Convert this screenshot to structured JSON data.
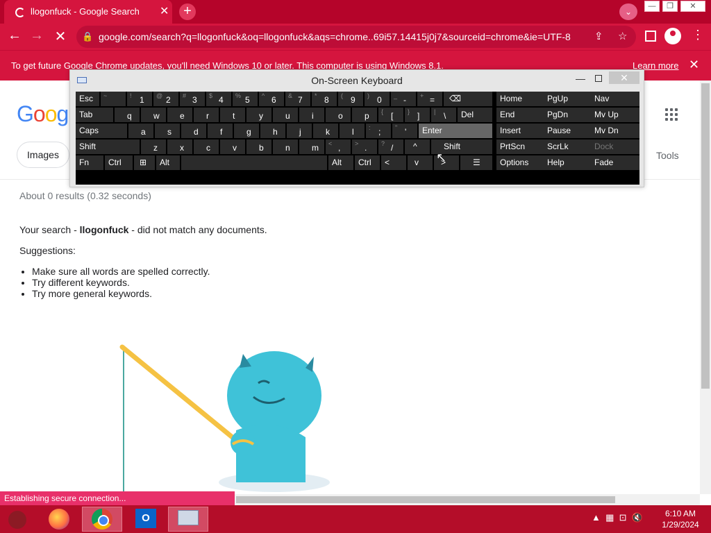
{
  "browser": {
    "tab_title": "llogonfuck - Google Search",
    "url": "google.com/search?q=llogonfuck&oq=llogonfuck&aqs=chrome..69i57.14415j0j7&sourceid=chrome&ie=UTF-8",
    "accent_color": "#d5153e"
  },
  "infobar": {
    "message": "To get future Google Chrome updates, you'll need Windows 10 or later. This computer is using Windows 8.1.",
    "link": "Learn more"
  },
  "google": {
    "logo": "Goog",
    "chip_images": "Images",
    "tools": "Tools",
    "result_stats": "About 0 results (0.32 seconds)",
    "no_match_prefix": "Your search - ",
    "query": "llogonfuck",
    "no_match_suffix": " - did not match any documents.",
    "suggestions_heading": "Suggestions:",
    "suggestions": [
      "Make sure all words are spelled correctly.",
      "Try different keywords.",
      "Try more general keywords."
    ]
  },
  "status": "Establishing secure connection...",
  "osk": {
    "title": "On-Screen Keyboard",
    "row1": [
      "Esc",
      "1",
      "2",
      "3",
      "4",
      "5",
      "6",
      "7",
      "8",
      "9",
      "0",
      "-",
      "="
    ],
    "row1_shift": [
      "~",
      "!",
      "@",
      "#",
      "$",
      "%",
      "^",
      "&",
      "*",
      "(",
      ")",
      "_",
      "+"
    ],
    "row2": [
      "Tab",
      "q",
      "w",
      "e",
      "r",
      "t",
      "y",
      "u",
      "i",
      "o",
      "p",
      "[",
      "]",
      "\\",
      "Del"
    ],
    "row2_shift": [
      "{",
      "}",
      "|"
    ],
    "row3": [
      "Caps",
      "a",
      "s",
      "d",
      "f",
      "g",
      "h",
      "j",
      "k",
      "l",
      ";",
      "'",
      "Enter"
    ],
    "row3_shift": [
      ":",
      "\""
    ],
    "row4": [
      "Shift",
      "z",
      "x",
      "c",
      "v",
      "b",
      "n",
      "m",
      ",",
      ".",
      "/",
      "^",
      "Shift"
    ],
    "row4_shift": [
      "<",
      ">",
      "?"
    ],
    "row5": [
      "Fn",
      "Ctrl",
      "Alt",
      "Alt",
      "Ctrl",
      "<",
      "v",
      ">"
    ],
    "nav": [
      [
        "Home",
        "PgUp",
        "Nav"
      ],
      [
        "End",
        "PgDn",
        "Mv Up"
      ],
      [
        "Insert",
        "Pause",
        "Mv Dn"
      ],
      [
        "PrtScn",
        "ScrLk",
        "Dock"
      ],
      [
        "Options",
        "Help",
        "Fade"
      ]
    ]
  },
  "taskbar": {
    "time": "6:10 AM",
    "date": "1/29/2024"
  }
}
